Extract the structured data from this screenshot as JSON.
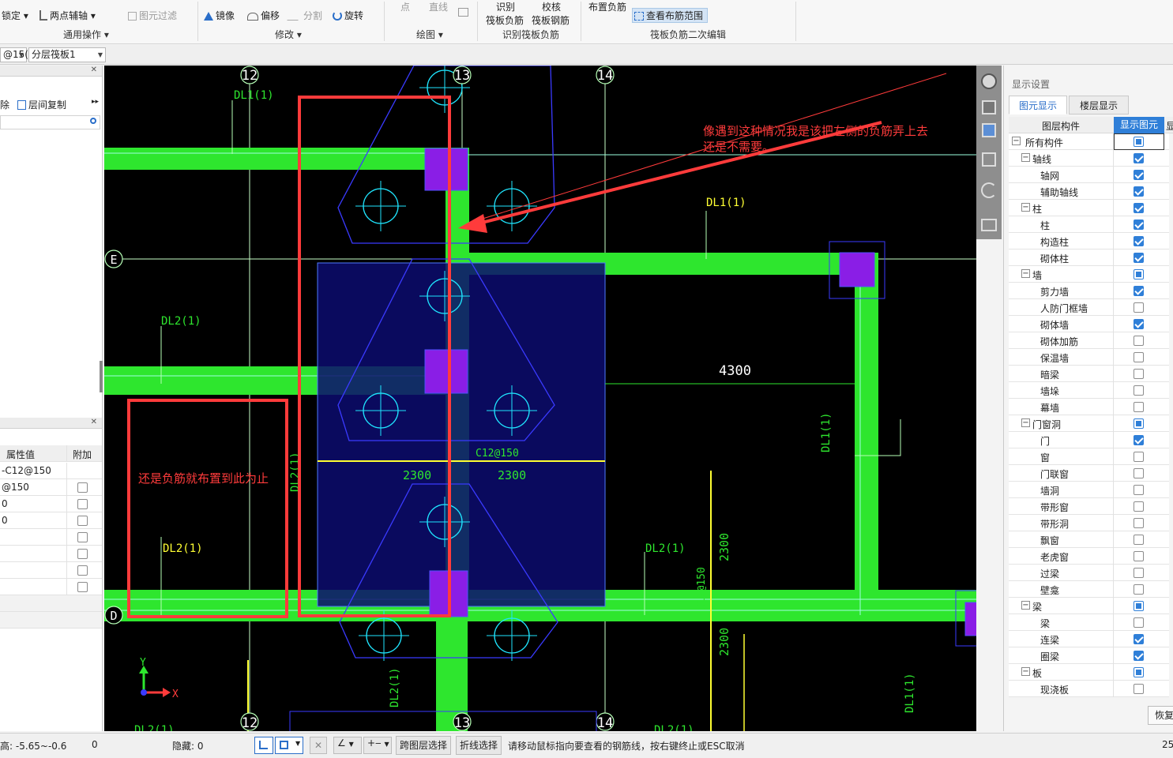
{
  "ribbon": {
    "lock": "锁定",
    "two_point_axis": "两点辅轴",
    "filter": "图元过滤",
    "mirror": "镜像",
    "offset": "偏移",
    "split": "分割",
    "rotate": "旋转",
    "point": "点",
    "line": "直线",
    "identify": "识别",
    "identify_sub": "筏板负筋",
    "check": "校核",
    "check_sub": "筏板钢筋",
    "arrange_neg": "布置负筋",
    "view_range": "查看布筋范围",
    "group_general": "通用操作",
    "group_modify": "修改",
    "group_draw": "绘图",
    "group_identify": "识别筏板负筋",
    "group_edit": "筏板负筋二次编辑"
  },
  "toolbar2": {
    "combo1": "@15(",
    "combo2": "分层筏板1"
  },
  "left_panel": {
    "delete_label": "除",
    "copy_label": "层间复制",
    "header_value": "属性值",
    "header_extra": "附加",
    "rows": [
      "-C12@150",
      "@150",
      "0",
      "0",
      "",
      "",
      "",
      ""
    ]
  },
  "canvas": {
    "axes_top": [
      "12",
      "13",
      "14"
    ],
    "axes_bottom": [
      "12",
      "13",
      "14"
    ],
    "axis_e": "E",
    "axis_d": "D",
    "dl1_a": "DL1(1)",
    "dl1_b": "DL1(1)",
    "dl1_c": "DL1(1)",
    "dl1_d": "DL1(1)",
    "dl2_a": "DL2(1)",
    "dl2_b": "DL2(1)",
    "dl2_c": "DL2(1)",
    "dl2_d": "DL2(1)",
    "dl2_e": "DL2(1)",
    "dl2_f": "DL2(1)",
    "dim_4300": "4300",
    "dim_2300_a": "2300",
    "dim_2300_b": "2300",
    "dim_2300_c": "2300",
    "dim_2300_d": "2300",
    "rebar_label": "C12@150",
    "rebar_label_v": "C12@150",
    "annotation_right": "像遇到这种情况我是该把左侧的负筋弄上去还是不需要。",
    "annotation_left": "还是负筋就布置到此为止",
    "x_axis": "X",
    "y_axis": "Y"
  },
  "right_panel": {
    "title": "显示设置",
    "tab1": "图元显示",
    "tab2": "楼层显示",
    "col_component": "图层构件",
    "col_show": "显示图元",
    "col_extra": "显",
    "restore_btn": "恢复",
    "tree": [
      {
        "label": "所有构件",
        "level": 0,
        "toggle": "−",
        "state": "part"
      },
      {
        "label": "轴线",
        "level": 1,
        "toggle": "−",
        "state": "on"
      },
      {
        "label": "轴网",
        "level": 2,
        "toggle": "",
        "state": "on"
      },
      {
        "label": "辅助轴线",
        "level": 2,
        "toggle": "",
        "state": "on"
      },
      {
        "label": "柱",
        "level": 1,
        "toggle": "−",
        "state": "on"
      },
      {
        "label": "柱",
        "level": 2,
        "toggle": "",
        "state": "on"
      },
      {
        "label": "构造柱",
        "level": 2,
        "toggle": "",
        "state": "on"
      },
      {
        "label": "砌体柱",
        "level": 2,
        "toggle": "",
        "state": "on"
      },
      {
        "label": "墙",
        "level": 1,
        "toggle": "−",
        "state": "part"
      },
      {
        "label": "剪力墙",
        "level": 2,
        "toggle": "",
        "state": "on"
      },
      {
        "label": "人防门框墙",
        "level": 2,
        "toggle": "",
        "state": "off"
      },
      {
        "label": "砌体墙",
        "level": 2,
        "toggle": "",
        "state": "on"
      },
      {
        "label": "砌体加筋",
        "level": 2,
        "toggle": "",
        "state": "off"
      },
      {
        "label": "保温墙",
        "level": 2,
        "toggle": "",
        "state": "off"
      },
      {
        "label": "暗梁",
        "level": 2,
        "toggle": "",
        "state": "off"
      },
      {
        "label": "墙垛",
        "level": 2,
        "toggle": "",
        "state": "off"
      },
      {
        "label": "幕墙",
        "level": 2,
        "toggle": "",
        "state": "off"
      },
      {
        "label": "门窗洞",
        "level": 1,
        "toggle": "−",
        "state": "part"
      },
      {
        "label": "门",
        "level": 2,
        "toggle": "",
        "state": "on"
      },
      {
        "label": "窗",
        "level": 2,
        "toggle": "",
        "state": "off"
      },
      {
        "label": "门联窗",
        "level": 2,
        "toggle": "",
        "state": "off"
      },
      {
        "label": "墙洞",
        "level": 2,
        "toggle": "",
        "state": "off"
      },
      {
        "label": "带形窗",
        "level": 2,
        "toggle": "",
        "state": "off"
      },
      {
        "label": "带形洞",
        "level": 2,
        "toggle": "",
        "state": "off"
      },
      {
        "label": "飘窗",
        "level": 2,
        "toggle": "",
        "state": "off"
      },
      {
        "label": "老虎窗",
        "level": 2,
        "toggle": "",
        "state": "off"
      },
      {
        "label": "过梁",
        "level": 2,
        "toggle": "",
        "state": "off"
      },
      {
        "label": "壁龛",
        "level": 2,
        "toggle": "",
        "state": "off"
      },
      {
        "label": "梁",
        "level": 1,
        "toggle": "−",
        "state": "part"
      },
      {
        "label": "梁",
        "level": 2,
        "toggle": "",
        "state": "off"
      },
      {
        "label": "连梁",
        "level": 2,
        "toggle": "",
        "state": "on"
      },
      {
        "label": "圈梁",
        "level": 2,
        "toggle": "",
        "state": "on"
      },
      {
        "label": "板",
        "level": 1,
        "toggle": "−",
        "state": "part"
      },
      {
        "label": "现浇板",
        "level": 2,
        "toggle": "",
        "state": "off"
      }
    ]
  },
  "status": {
    "height": "高: -5.65~-0.6",
    "zero": "0",
    "hidden": "隐藏: 0",
    "cross_layer": "跨图层选择",
    "polyline": "折线选择",
    "hint": "请移动鼠标指向要查看的钢筋线，按右键终止或ESC取消",
    "right_num": "25"
  },
  "colors": {
    "beam": "#2ee62e",
    "column": "#8a1ee6",
    "annotation": "#ff3b3b",
    "axis": "#b6ffb6",
    "label_yellow": "#ffff33",
    "raft_fill": "#0c0c6e",
    "checkbox_on": "#2f7fd8"
  }
}
